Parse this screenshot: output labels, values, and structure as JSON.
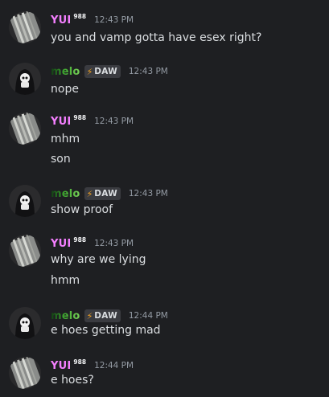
{
  "users": {
    "yui": {
      "name": "YUI",
      "badge": "988"
    },
    "melo": {
      "name": "melo",
      "tag": "DAW",
      "tag_icon": "lightning-icon"
    }
  },
  "messages": [
    {
      "user": "YUI",
      "badge": "988",
      "time": "12:43 PM",
      "lines": [
        "you and vamp gotta have esex right?"
      ]
    },
    {
      "user": "melo",
      "tag": "DAW",
      "time": "12:43 PM",
      "lines": [
        "nope"
      ]
    },
    {
      "user": "YUI",
      "badge": "988",
      "time": "12:43 PM",
      "lines": [
        "mhm",
        "son"
      ]
    },
    {
      "user": "melo",
      "tag": "DAW",
      "time": "12:43 PM",
      "lines": [
        "show proof"
      ]
    },
    {
      "user": "YUI",
      "badge": "988",
      "time": "12:43 PM",
      "lines": [
        "why are we lying",
        "hmm"
      ]
    },
    {
      "user": "melo",
      "tag": "DAW",
      "time": "12:44 PM",
      "lines": [
        "e hoes getting mad"
      ]
    },
    {
      "user": "YUI",
      "badge": "988",
      "time": "12:44 PM",
      "lines": [
        "e hoes?"
      ]
    }
  ],
  "colors": {
    "background": "#1e1f22",
    "yui_name": "#f47fff",
    "melo_name": "#3ea52f",
    "timestamp": "#949ba4",
    "text": "#dbdee1"
  }
}
